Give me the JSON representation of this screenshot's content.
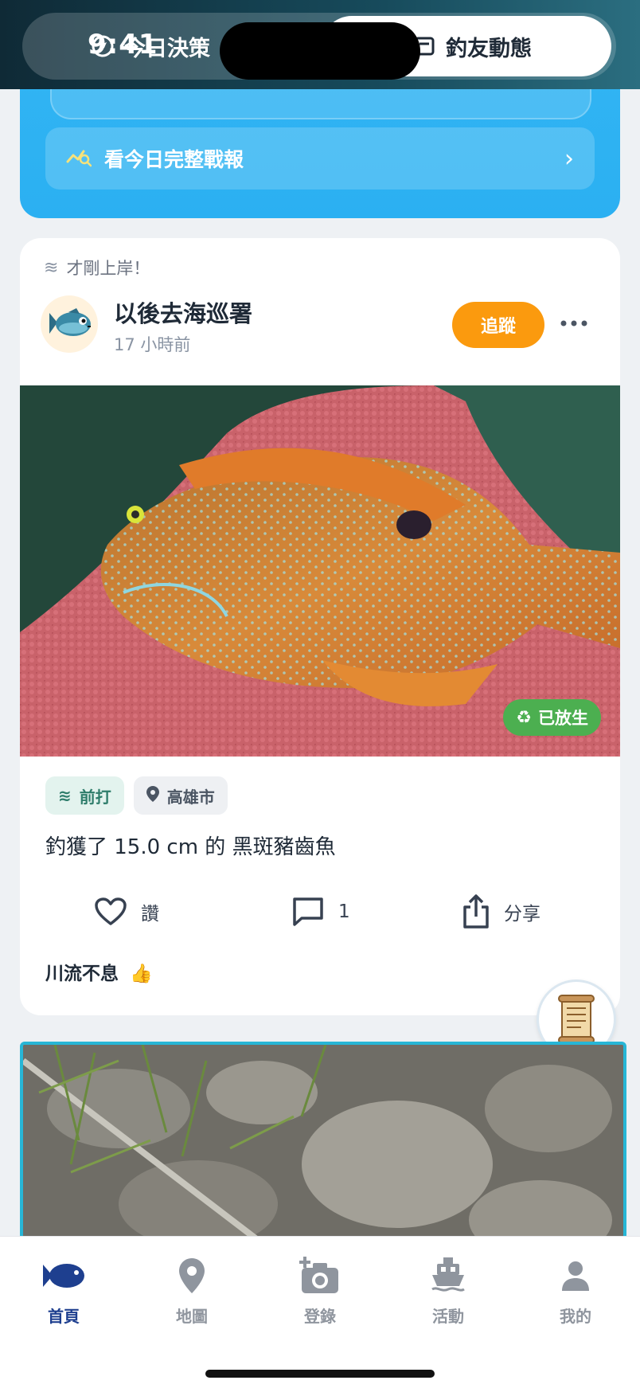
{
  "status_bar": {
    "time": "9:41"
  },
  "header": {
    "tabs": [
      {
        "label": "今日決策",
        "active": false
      },
      {
        "label": "釣友動態",
        "active": true
      }
    ]
  },
  "banner": {
    "report_button_label": "看今日完整戰報",
    "chevron": "›"
  },
  "post": {
    "tag": "才剛上岸！",
    "username": "以後去海巡署",
    "time_ago": "17 小時前",
    "follow_label": "追蹤",
    "released_label": "已放生",
    "chips": {
      "method": "前打",
      "location": "高雄市"
    },
    "catch_text": "釣獲了 15.0 cm 的 黑斑豬齒魚",
    "actions": {
      "like_label": "讚",
      "comment_count": "1",
      "share_label": "分享"
    },
    "comment": {
      "author": "川流不息",
      "emoji": "👍"
    }
  },
  "bottom_nav": {
    "items": [
      {
        "label": "首頁",
        "icon": "fish-icon",
        "active": true
      },
      {
        "label": "地圖",
        "icon": "map-pin-icon",
        "active": false
      },
      {
        "label": "登錄",
        "icon": "camera-add-icon",
        "active": false
      },
      {
        "label": "活動",
        "icon": "boat-icon",
        "active": false
      },
      {
        "label": "我的",
        "icon": "person-icon",
        "active": false
      }
    ]
  },
  "colors": {
    "accent_blue": "#2bb0f2",
    "follow_orange": "#fb9a0e",
    "release_green": "#4caf50",
    "nav_active": "#1e3f8f"
  }
}
